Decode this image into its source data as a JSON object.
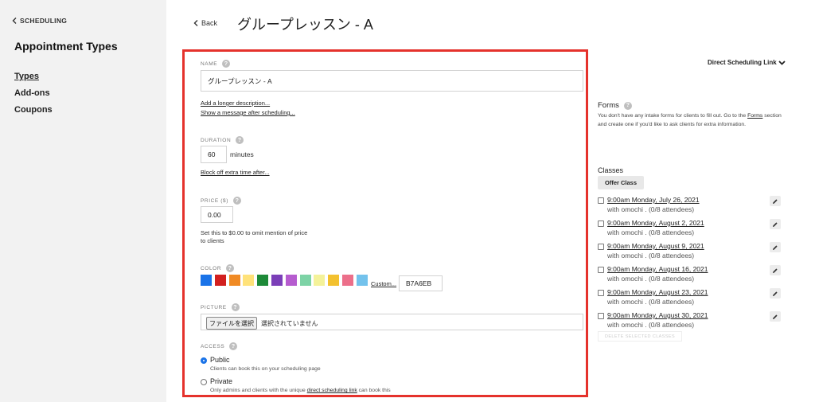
{
  "sidebar": {
    "back_label": "SCHEDULING",
    "title": "Appointment Types",
    "items": [
      {
        "label": "Types",
        "active": true
      },
      {
        "label": "Add-ons",
        "active": false
      },
      {
        "label": "Coupons",
        "active": false
      }
    ]
  },
  "header": {
    "back_label": "Back",
    "title": "グループレッスン - A"
  },
  "form": {
    "name_label": "NAME",
    "name_value": "グループレッスン - A",
    "add_description_link": "Add a longer description...",
    "show_message_link": "Show a message after scheduling...",
    "duration_label": "DURATION",
    "duration_value": "60",
    "duration_unit": "minutes",
    "block_off_link": "Block off extra time after...",
    "price_label": "PRICE ($)",
    "price_value": "0.00",
    "price_hint_line1": "Set this to $0.00 to omit mention of price",
    "price_hint_line2": "to clients",
    "color_label": "COLOR",
    "colors": [
      "#1a73e8",
      "#d22020",
      "#f08a24",
      "#ffe27a",
      "#1d8a38",
      "#7b3fb8",
      "#b65ccf",
      "#7dd3a6",
      "#f4f29a",
      "#f3c12f",
      "#ec6f8a",
      "#73c2ec"
    ],
    "custom_link": "Custom...",
    "custom_value": "B7A6EB",
    "picture_label": "PICTURE",
    "file_button": "ファイルを選択",
    "file_status": "選択されていません",
    "access_label": "ACCESS",
    "access_public_label": "Public",
    "access_public_desc": "Clients can book this on your scheduling page",
    "access_private_label": "Private",
    "access_private_desc_prefix": "Only admins and clients with the unique",
    "access_private_link": "direct scheduling link",
    "access_private_desc_suffix": "can book this"
  },
  "right": {
    "direct_link_label": "Direct Scheduling Link",
    "forms_title": "Forms",
    "forms_desc_1": "You don't have any intake forms for clients to fill out. Go to the",
    "forms_link": "Forms",
    "forms_desc_2": "section and create one if you'd like to ask clients for extra information.",
    "classes_title": "Classes",
    "offer_class_button": "Offer Class",
    "classes": [
      {
        "date": "9:00am Monday, July 26, 2021",
        "with": "with omochi . (0/8 attendees)"
      },
      {
        "date": "9:00am Monday, August 2, 2021",
        "with": "with omochi . (0/8 attendees)"
      },
      {
        "date": "9:00am Monday, August 9, 2021",
        "with": "with omochi . (0/8 attendees)"
      },
      {
        "date": "9:00am Monday, August 16, 2021",
        "with": "with omochi . (0/8 attendees)"
      },
      {
        "date": "9:00am Monday, August 23, 2021",
        "with": "with omochi . (0/8 attendees)"
      },
      {
        "date": "9:00am Monday, August 30, 2021",
        "with": "with omochi . (0/8 attendees)"
      }
    ],
    "delete_selected_button": "DELETE SELECTED CLASSES"
  },
  "icons": {
    "help": "question-circle-icon",
    "back": "chevron-left-icon",
    "dropdown": "chevron-down-icon",
    "edit": "pencil-icon"
  },
  "colors": {
    "highlight_border": "#e5322c",
    "sidebar_bg": "#f2f2f2",
    "radio_selected": "#1a73e8"
  }
}
